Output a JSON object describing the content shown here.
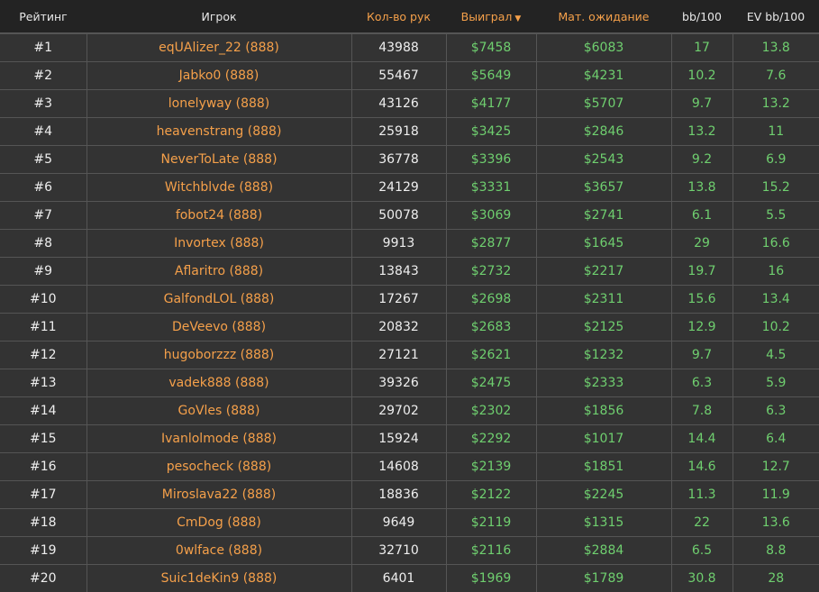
{
  "headers": {
    "rank": "Рейтинг",
    "player": "Игрок",
    "hands": "Кол-во рук",
    "won": "Выиграл",
    "won_sort": "▼",
    "ev": "Мат. ожидание",
    "bb100": "bb/100",
    "evbb100": "EV bb/100"
  },
  "colors": {
    "accent": "#f5a04a",
    "green": "#6fcf6f",
    "bg": "#333333",
    "header_bg": "#232323"
  },
  "rows": [
    [
      "#1",
      "eqUAlizer_22 (888)",
      "43988",
      "$7458",
      "$6083",
      "17",
      "13.8"
    ],
    [
      "#2",
      "Jabko0 (888)",
      "55467",
      "$5649",
      "$4231",
      "10.2",
      "7.6"
    ],
    [
      "#3",
      "lonelyway (888)",
      "43126",
      "$4177",
      "$5707",
      "9.7",
      "13.2"
    ],
    [
      "#4",
      "heavenstrang (888)",
      "25918",
      "$3425",
      "$2846",
      "13.2",
      "11"
    ],
    [
      "#5",
      "NeverToLate (888)",
      "36778",
      "$3396",
      "$2543",
      "9.2",
      "6.9"
    ],
    [
      "#6",
      "Witchblvde (888)",
      "24129",
      "$3331",
      "$3657",
      "13.8",
      "15.2"
    ],
    [
      "#7",
      "fobot24 (888)",
      "50078",
      "$3069",
      "$2741",
      "6.1",
      "5.5"
    ],
    [
      "#8",
      "Invortex (888)",
      "9913",
      "$2877",
      "$1645",
      "29",
      "16.6"
    ],
    [
      "#9",
      "Aflaritro (888)",
      "13843",
      "$2732",
      "$2217",
      "19.7",
      "16"
    ],
    [
      "#10",
      "GalfondLOL (888)",
      "17267",
      "$2698",
      "$2311",
      "15.6",
      "13.4"
    ],
    [
      "#11",
      "DeVeevo (888)",
      "20832",
      "$2683",
      "$2125",
      "12.9",
      "10.2"
    ],
    [
      "#12",
      "hugoborzzz (888)",
      "27121",
      "$2621",
      "$1232",
      "9.7",
      "4.5"
    ],
    [
      "#13",
      "vadek888 (888)",
      "39326",
      "$2475",
      "$2333",
      "6.3",
      "5.9"
    ],
    [
      "#14",
      "GoVles (888)",
      "29702",
      "$2302",
      "$1856",
      "7.8",
      "6.3"
    ],
    [
      "#15",
      "Ivanlolmode (888)",
      "15924",
      "$2292",
      "$1017",
      "14.4",
      "6.4"
    ],
    [
      "#16",
      "pesocheck (888)",
      "14608",
      "$2139",
      "$1851",
      "14.6",
      "12.7"
    ],
    [
      "#17",
      "Miroslava22 (888)",
      "18836",
      "$2122",
      "$2245",
      "11.3",
      "11.9"
    ],
    [
      "#18",
      "CmDog (888)",
      "9649",
      "$2119",
      "$1315",
      "22",
      "13.6"
    ],
    [
      "#19",
      "0wlface (888)",
      "32710",
      "$2116",
      "$2884",
      "6.5",
      "8.8"
    ],
    [
      "#20",
      "Suic1deKin9 (888)",
      "6401",
      "$1969",
      "$1789",
      "30.8",
      "28"
    ]
  ]
}
